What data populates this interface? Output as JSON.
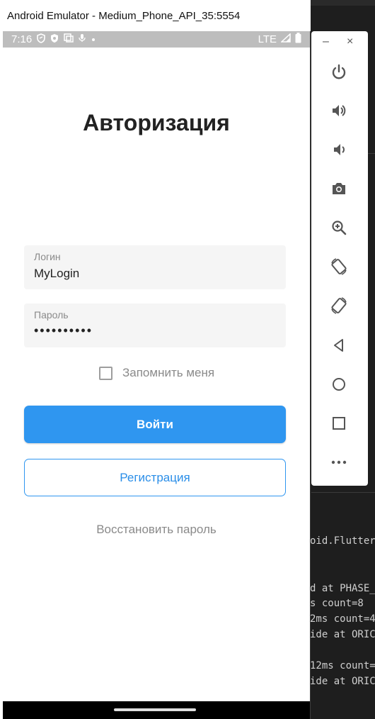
{
  "window": {
    "title": "Android Emulator - Medium_Phone_API_35:5554"
  },
  "status_bar": {
    "time": "7:16",
    "network": "LTE"
  },
  "app": {
    "title": "Авторизация",
    "login_field": {
      "label": "Логин",
      "value": "MyLogin"
    },
    "password_field": {
      "label": "Пароль",
      "value": "••••••••••"
    },
    "remember_me": {
      "label": "Запомнить меня",
      "checked": false
    },
    "login_button": "Войти",
    "register_button": "Регистрация",
    "restore_link": "Восстановить пароль"
  },
  "emulator_toolbar": {
    "minimize": "–",
    "close": "×",
    "buttons": [
      "power-icon",
      "volume-up-icon",
      "volume-down-icon",
      "camera-icon",
      "zoom-icon",
      "rotate-left-icon",
      "rotate-right-icon",
      "back-icon",
      "home-icon",
      "overview-icon",
      "more-icon"
    ]
  },
  "terminal_lines": [
    "oid.Flutter",
    "d at PHASE_",
    "s count=8",
    "2ms count=4",
    "ide at ORIC",
    "12ms count=",
    "ide at ORIC"
  ],
  "colors": {
    "primary": "#2f96f0",
    "status_bar": "#bdbdbd",
    "field_bg": "#f5f5f5"
  }
}
